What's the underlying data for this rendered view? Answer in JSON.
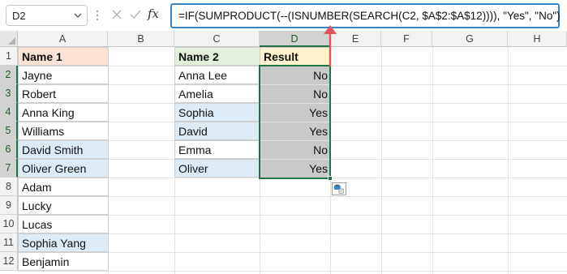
{
  "formula_bar": {
    "name_box": "D2",
    "fx_label": "fx",
    "formula": "=IF(SUMPRODUCT(--(ISNUMBER(SEARCH(C2, $A$2:$A$12)))), \"Yes\", \"No\")"
  },
  "columns": [
    "A",
    "B",
    "C",
    "D",
    "E",
    "F",
    "G",
    "H"
  ],
  "rows": [
    "1",
    "2",
    "3",
    "4",
    "5",
    "6",
    "7",
    "8",
    "9",
    "10",
    "11",
    "12"
  ],
  "sheet": {
    "col_a_header": "Name 1",
    "col_a": [
      "Jayne",
      "Robert",
      "Anna King",
      "Williams",
      "David Smith",
      "Oliver Green",
      "Adam",
      "Lucky",
      "Lucas",
      "Sophia Yang",
      "Benjamin"
    ],
    "col_c_header": "Name 2",
    "col_c": [
      "Anna Lee",
      "Amelia",
      "Sophia",
      "David",
      "Emma",
      "Oliver"
    ],
    "col_d_header": "Result",
    "col_d": [
      "No",
      "No",
      "Yes",
      "Yes",
      "No",
      "Yes"
    ]
  },
  "colors": {
    "accent": "#217346",
    "formula_border": "#3a84c9",
    "arrow": "#e0565d",
    "highlight_blue": "#ddebf7",
    "header_orange": "#fbe2d5",
    "header_green": "#e2efda",
    "header_yellow": "#fff2cc"
  },
  "icons": {
    "name_box_dropdown": "chevron-down-icon",
    "cancel": "close-icon",
    "enter": "check-icon",
    "paste_options": "paste-options-icon",
    "annotation": "arrow-up-icon"
  }
}
